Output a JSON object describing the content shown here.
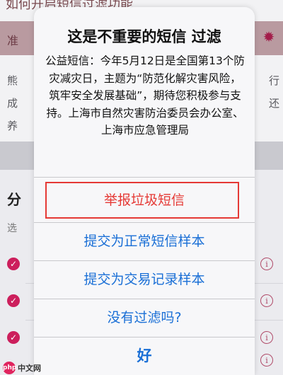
{
  "background": {
    "title": "如何开启短信过滤功能",
    "banner_label": "准",
    "para_lines": [
      "熊",
      "成",
      "养"
    ],
    "right_lines": [
      "行",
      "还"
    ],
    "section_heading": "分",
    "section_sub": "选"
  },
  "dialog": {
    "title": "这是不重要的短信 过滤",
    "message": "公益短信：今年5月12日是全国第13个防灾减灾日，主题为“防范化解灾害风险，筑牢安全发展基础”，期待您积极参与支持。上海市自然灾害防治委员会办公室、上海市应急管理局",
    "actions": {
      "report_spam": "举报垃圾短信",
      "submit_normal": "提交为正常短信样本",
      "submit_transaction": "提交为交易记录样本",
      "not_filtered": "没有过滤吗?",
      "ok": "好"
    }
  },
  "watermark": {
    "badge": "php",
    "text": "中文网"
  },
  "colors": {
    "destructive": "#e53935",
    "action": "#1a6fd6",
    "accent": "#cc1f5c"
  }
}
